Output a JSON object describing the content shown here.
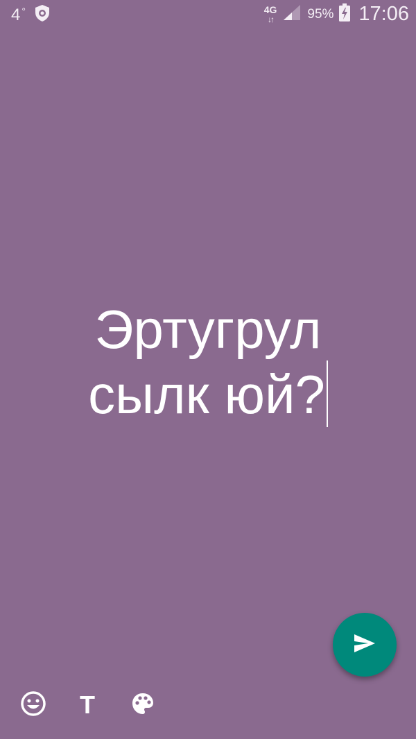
{
  "status_bar": {
    "temperature": "4",
    "degree_symbol": "°",
    "network_type": "4G",
    "battery_percent": "95%",
    "time": "17:06"
  },
  "editor": {
    "text_line1": "Эртугрул",
    "text_line2": "сылк юй?"
  },
  "toolbar": {
    "text_tool_label": "T"
  },
  "colors": {
    "background": "#8a6a8f",
    "send_button": "#00897b",
    "foreground": "#ffffff"
  },
  "icons": {
    "weather": "shield-icon",
    "emoji": "emoji-icon",
    "palette": "palette-icon",
    "send": "send-icon"
  }
}
